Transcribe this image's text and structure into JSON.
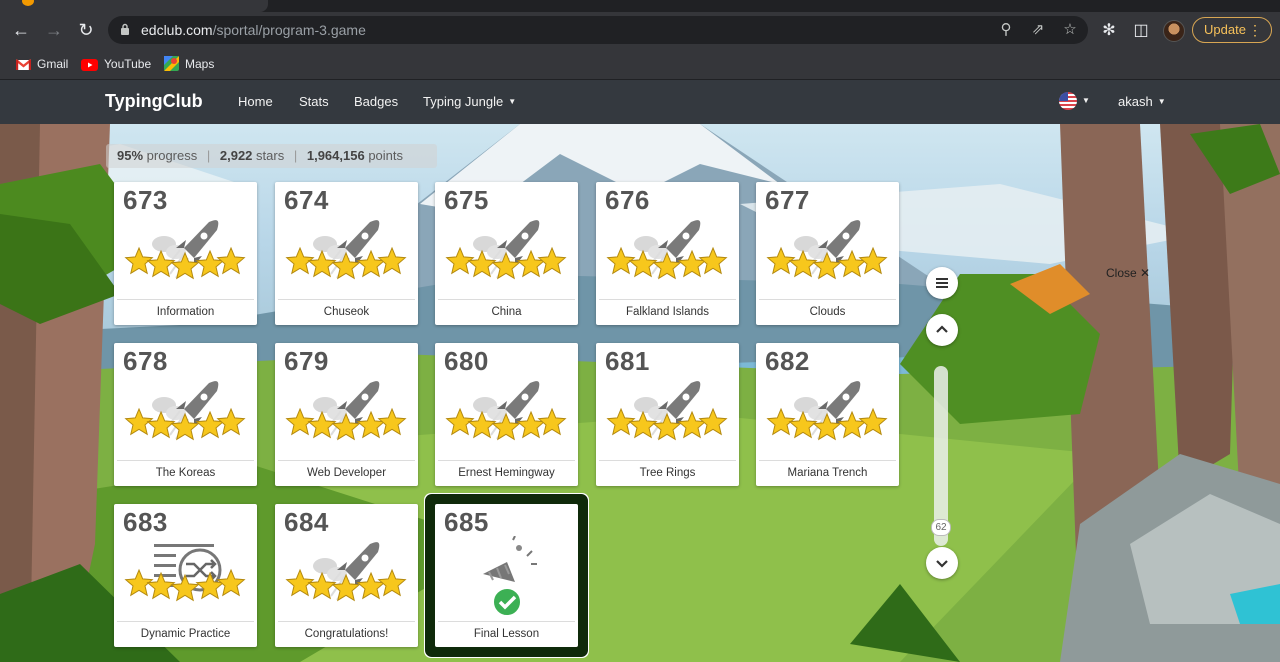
{
  "browser": {
    "url_host": "edclub.com",
    "url_path": "/sportal/program-3.game",
    "update_label": "Update",
    "bookmarks": [
      {
        "label": "Gmail",
        "icon": "gmail-icon"
      },
      {
        "label": "YouTube",
        "icon": "youtube-icon"
      },
      {
        "label": "Maps",
        "icon": "maps-icon"
      }
    ]
  },
  "header": {
    "brand": "TypingClub",
    "nav": [
      "Home",
      "Stats",
      "Badges",
      "Typing Jungle"
    ],
    "user": "akash"
  },
  "progress": {
    "percent": "95%",
    "percent_label": "progress",
    "stars": "2,922",
    "stars_label": "stars",
    "points": "1,964,156",
    "points_label": "points"
  },
  "lessons": [
    {
      "number": "673",
      "name": "Information",
      "icon": "rocket-icon",
      "stars": 5
    },
    {
      "number": "674",
      "name": "Chuseok",
      "icon": "rocket-icon",
      "stars": 5
    },
    {
      "number": "675",
      "name": "China",
      "icon": "rocket-icon",
      "stars": 5
    },
    {
      "number": "676",
      "name": "Falkland Islands",
      "icon": "rocket-icon",
      "stars": 5
    },
    {
      "number": "677",
      "name": "Clouds",
      "icon": "rocket-icon",
      "stars": 5
    },
    {
      "number": "678",
      "name": "The Koreas",
      "icon": "rocket-icon",
      "stars": 5
    },
    {
      "number": "679",
      "name": "Web Developer",
      "icon": "rocket-icon",
      "stars": 5
    },
    {
      "number": "680",
      "name": "Ernest Hemingway",
      "icon": "rocket-icon",
      "stars": 5
    },
    {
      "number": "681",
      "name": "Tree Rings",
      "icon": "rocket-icon",
      "stars": 5
    },
    {
      "number": "682",
      "name": "Mariana Trench",
      "icon": "rocket-icon",
      "stars": 5
    },
    {
      "number": "683",
      "name": "Dynamic Practice",
      "icon": "shuffle-icon",
      "stars": 5
    },
    {
      "number": "684",
      "name": "Congratulations!",
      "icon": "rocket-icon",
      "stars": 5
    },
    {
      "number": "685",
      "name": "Final Lesson",
      "icon": "party-popper-icon",
      "stars": 0
    }
  ],
  "sidebar": {
    "scroll_value": "62",
    "close_label": "Close"
  },
  "colors": {
    "star": "#f7c71c",
    "check": "#3cb054",
    "header_bg": "#34393f"
  }
}
